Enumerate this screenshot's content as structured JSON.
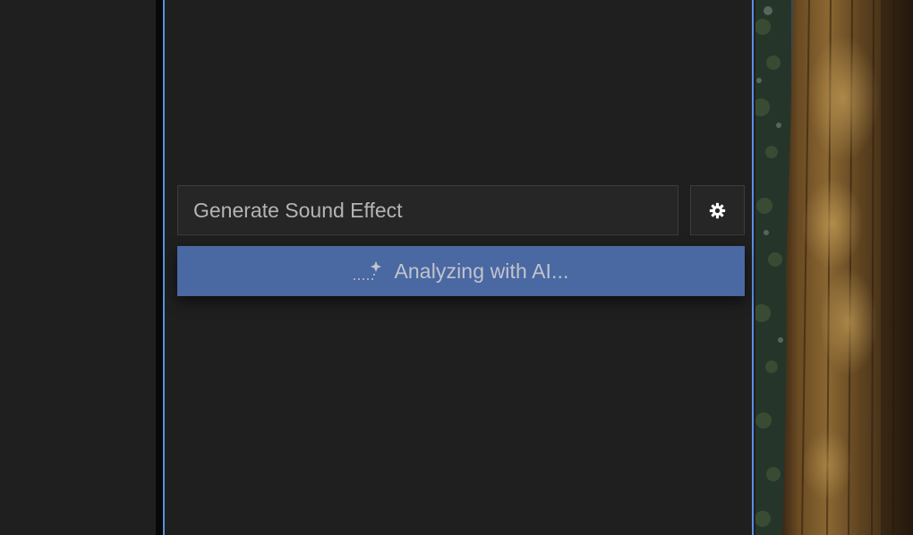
{
  "sound_effect": {
    "input_placeholder": "Generate Sound Effect",
    "input_value": "",
    "settings_icon": "gear-icon",
    "analyze_label": "Analyzing with AI...",
    "analyze_icon": "sparkle-icon"
  },
  "video_preview": {
    "subject": "forest tree trunk"
  },
  "colors": {
    "background": "#1f1f20",
    "panel_border": "#5b8fe0",
    "input_background": "#262627",
    "analyze_button": "#4a68a2",
    "text": "#b4b4b4"
  }
}
